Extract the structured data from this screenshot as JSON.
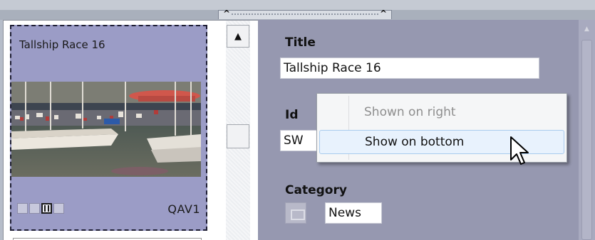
{
  "card": {
    "title": "Tallship Race 16",
    "code": "QAV1",
    "media_icons": [
      "image-icon",
      "audio-icon",
      "video-icon",
      "person-icon"
    ],
    "active_media": "video-icon"
  },
  "form": {
    "title_label": "Title",
    "title_value": "Tallship Race 16",
    "id_label": "Id",
    "id_value": "SW",
    "category_label": "Category",
    "category_value": "News"
  },
  "context_menu": {
    "items": [
      {
        "label": "Shown on right",
        "enabled": false
      },
      {
        "label": "Show on bottom",
        "enabled": true,
        "hovered": true
      }
    ]
  },
  "colors": {
    "card_background": "#9b9cc6",
    "right_pane_background": "#9698b0",
    "menu_hover": "#e8f2fd"
  }
}
